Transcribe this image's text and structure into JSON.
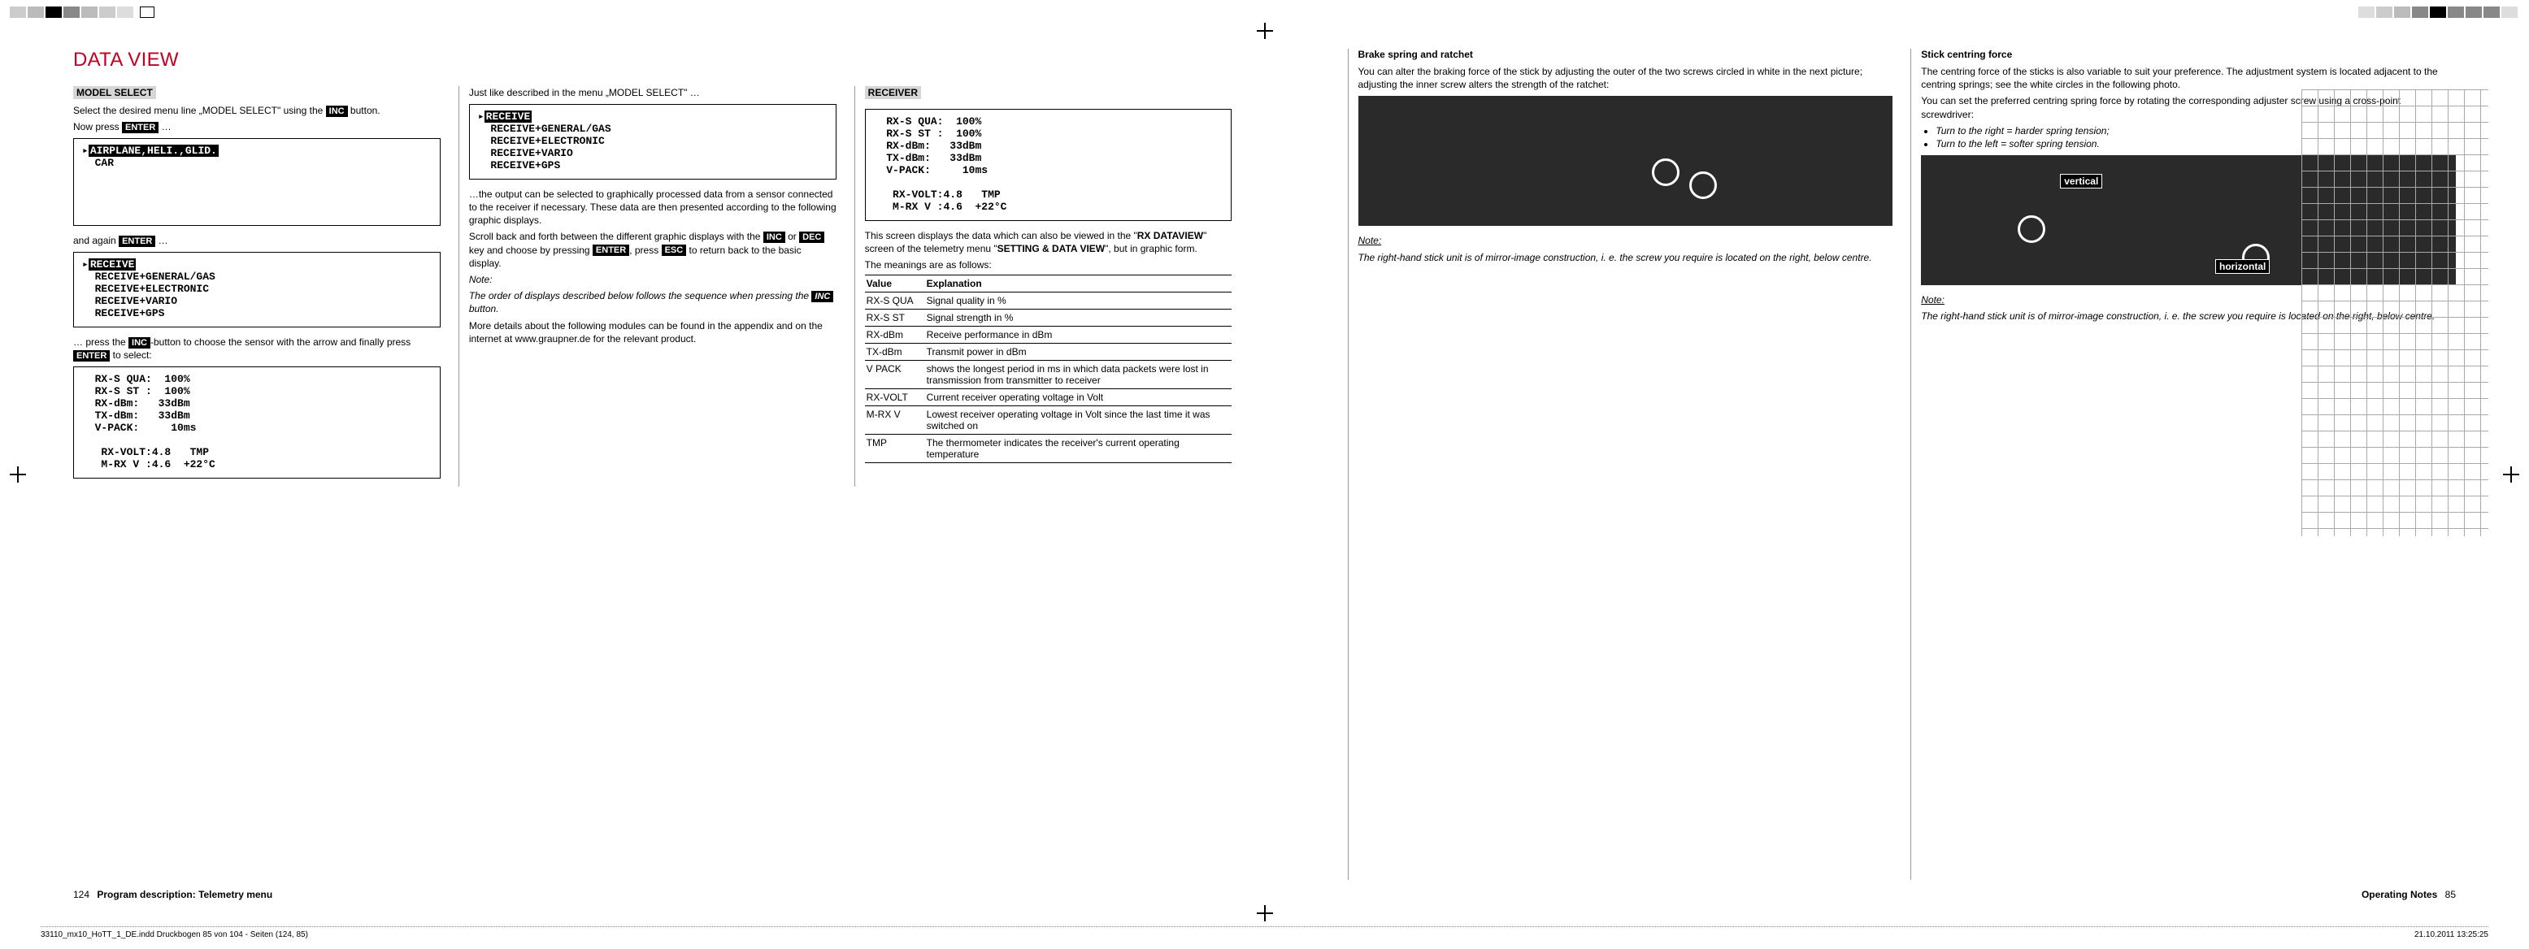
{
  "title": "DATA VIEW",
  "colA": {
    "head": "MODEL SELECT",
    "p1a": "Select the desired menu line „MODEL SELECT\" using the ",
    "inc": "INC",
    "p1b": " button.",
    "p2a": "Now press ",
    "enter": "ENTER",
    "p2b": " …",
    "lcd1_l1_inv": "AIRPLANE,HELI.,GLID.",
    "lcd1_l2": "  CAR",
    "p3a": "and again ",
    "p3b": " …",
    "lcd2_l1_inv": "RECEIVE",
    "lcd2_l2": "  RECEIVE+GENERAL/GAS",
    "lcd2_l3": "  RECEIVE+ELECTRONIC",
    "lcd2_l4": "  RECEIVE+VARIO",
    "lcd2_l5": "  RECEIVE+GPS",
    "p4a": "… press the ",
    "p4b": "-button to choose the sensor with the arrow and finally press ",
    "p4c": " to select:",
    "lcd3_l1": "  RX-S QUA:  100%",
    "lcd3_l2": "  RX-S ST :  100%",
    "lcd3_l3": "  RX-dBm:   33dBm",
    "lcd3_l4": "  TX-dBm:   33dBm",
    "lcd3_l5": "  V-PACK:     10ms",
    "lcd3_l6": "   RX-VOLT:4.8   TMP",
    "lcd3_l7": "   M-RX V :4.6  +22°C"
  },
  "colB": {
    "p0": "Just like described  in the menu „MODEL SELECT\" …",
    "lcd_l1_inv": "RECEIVE",
    "lcd_l2": "  RECEIVE+GENERAL/GAS",
    "lcd_l3": "  RECEIVE+ELECTRONIC",
    "lcd_l4": "  RECEIVE+VARIO",
    "lcd_l5": "  RECEIVE+GPS",
    "p1": "…the output can be selected to graphically processed data from a sensor connected to the receiver if necessary. These data are then presented according to the following graphic displays.",
    "p2a": "Scroll back and forth between the different graphic displays with the ",
    "p2b": " or ",
    "dec": "DEC",
    "p2c": " key and choose by pressing ",
    "p2d": ", press ",
    "esc": "ESC",
    "p2e": " to return back to the basic display.",
    "note": "Note:",
    "note_body_a": "The order of displays described below follows the sequence when pressing the ",
    "note_body_b": " button.",
    "p3": "More details about the following modules can be found in the appendix and on the internet at www.graupner.de for the relevant product."
  },
  "colC": {
    "head": "RECEIVER",
    "lcd_l1": "  RX-S QUA:  100%",
    "lcd_l2": "  RX-S ST :  100%",
    "lcd_l3": "  RX-dBm:   33dBm",
    "lcd_l4": "  TX-dBm:   33dBm",
    "lcd_l5": "  V-PACK:     10ms",
    "lcd_l6": "   RX-VOLT:4.8   TMP",
    "lcd_l7": "   M-RX V :4.6  +22°C",
    "p1a": "This screen displays the data which can also be viewed in the \"",
    "p1b": "RX DATAVIEW",
    "p1c": "\" screen of the telemetry menu \"",
    "p1d": "SETTING & DATA VIEW",
    "p1e": "\", but in graphic form.",
    "p2": "The meanings are as follows:",
    "th1": "Value",
    "th2": "Explanation",
    "rows": [
      {
        "v": "RX-S QUA",
        "e": "Signal quality in %"
      },
      {
        "v": "RX-S ST",
        "e": "Signal strength in %"
      },
      {
        "v": "RX-dBm",
        "e": "Receive performance in dBm"
      },
      {
        "v": "TX-dBm",
        "e": "Transmit power in dBm"
      },
      {
        "v": "V PACK",
        "e": "shows the longest period in ms in which data packets were lost in transmission from transmitter to receiver"
      },
      {
        "v": "RX-VOLT",
        "e": "Current receiver operating voltage in Volt"
      },
      {
        "v": "M-RX V",
        "e": "Lowest receiver operating voltage in Volt since the last time it was switched on"
      },
      {
        "v": "TMP",
        "e": "The thermometer indicates the receiver's current operating temperature"
      }
    ]
  },
  "right": {
    "brake_head": "Brake spring and ratchet",
    "brake_p1": "You can alter the braking force of the stick by adjusting the outer of the two screws circled in white in the next picture; adjusting the inner screw alters the strength of the ratchet:",
    "brake_note": "Note:",
    "brake_note_body": "The right-hand stick unit is of mirror-image construction, i. e. the screw you require is located on the right, below centre.",
    "centre_head": "Stick centring force",
    "centre_p1": "The centring force of the sticks is also variable to suit your preference. The adjustment system is located adjacent to the centring springs; see the white circles in the following photo.",
    "centre_p2": "You can set the preferred centring spring force by rotating the corresponding adjuster screw using a cross-point screwdriver:",
    "centre_li1": "Turn to the right  = harder spring tension;",
    "centre_li2": "Turn to the left   = softer spring tension.",
    "tag_vert": "vertical",
    "tag_horiz": "horizontal",
    "centre_note": "Note:",
    "centre_note_body": "The right-hand stick unit is of mirror-image construction, i. e. the screw you require is located on the right, below centre."
  },
  "footer": {
    "left_num": "124",
    "left_title": "Program description: Telemetry menu",
    "right_title": "Operating Notes",
    "right_num": "85"
  },
  "imposition": {
    "file": "33110_mx10_HoTT_1_DE.indd   Druckbogen 85 von 104 - Seiten (124, 85)",
    "ts": "21.10.2011   13:25:25"
  }
}
